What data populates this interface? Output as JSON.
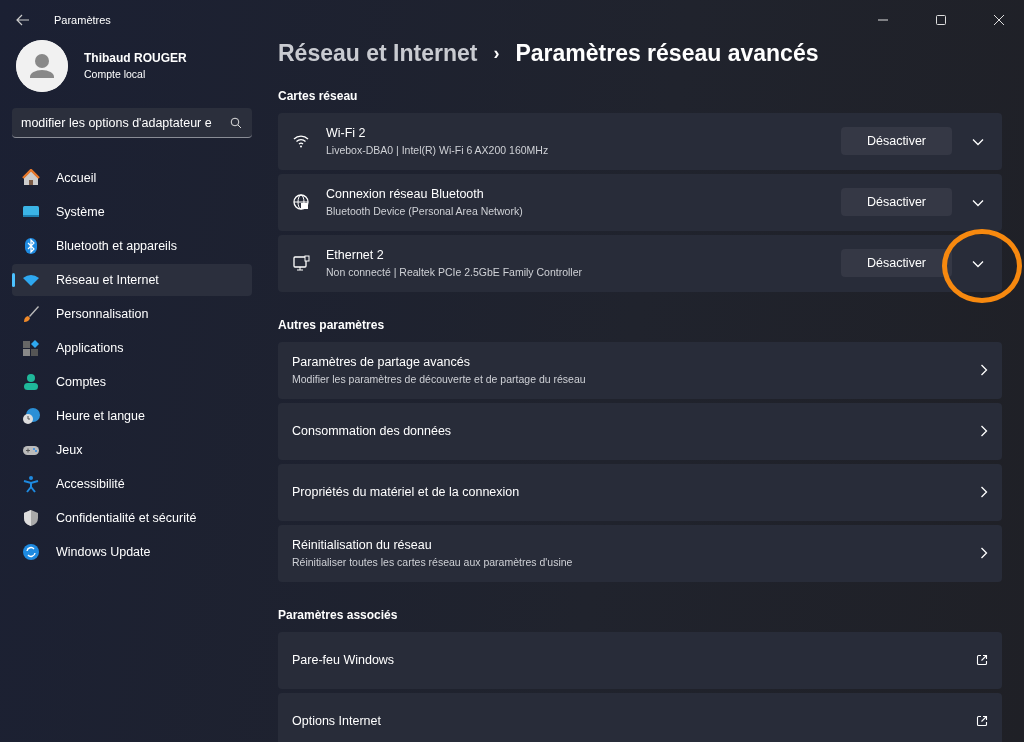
{
  "window": {
    "title": "Paramètres"
  },
  "user": {
    "name": "Thibaud ROUGER",
    "account": "Compte local"
  },
  "search": {
    "value": "modifier les options d'adaptateur e"
  },
  "sidebar": {
    "items": [
      {
        "label": "Accueil",
        "selected": false
      },
      {
        "label": "Système",
        "selected": false
      },
      {
        "label": "Bluetooth et appareils",
        "selected": false
      },
      {
        "label": "Réseau et Internet",
        "selected": true
      },
      {
        "label": "Personnalisation",
        "selected": false
      },
      {
        "label": "Applications",
        "selected": false
      },
      {
        "label": "Comptes",
        "selected": false
      },
      {
        "label": "Heure et langue",
        "selected": false
      },
      {
        "label": "Jeux",
        "selected": false
      },
      {
        "label": "Accessibilité",
        "selected": false
      },
      {
        "label": "Confidentialité et sécurité",
        "selected": false
      },
      {
        "label": "Windows Update",
        "selected": false
      }
    ]
  },
  "breadcrumb": {
    "parent": "Réseau et Internet",
    "separator": "›",
    "current": "Paramètres réseau avancés"
  },
  "sections": [
    {
      "title": "Cartes réseau",
      "kind": "adapters",
      "rows": [
        {
          "title": "Wi-Fi 2",
          "subtitle": "Livebox-DBA0 | Intel(R) Wi-Fi 6 AX200 160MHz",
          "button": "Désactiver",
          "highlighted": false
        },
        {
          "title": "Connexion réseau Bluetooth",
          "subtitle": "Bluetooth Device (Personal Area Network)",
          "button": "Désactiver",
          "highlighted": false
        },
        {
          "title": "Ethernet 2",
          "subtitle": "Non connecté | Realtek PCIe 2.5GbE Family Controller",
          "button": "Désactiver",
          "highlighted": true
        }
      ]
    },
    {
      "title": "Autres paramètres",
      "kind": "links",
      "rows": [
        {
          "title": "Paramètres de partage avancés",
          "subtitle": "Modifier les paramètres de découverte et de partage du réseau"
        },
        {
          "title": "Consommation des données"
        },
        {
          "title": "Propriétés du matériel et de la connexion"
        },
        {
          "title": "Réinitialisation du réseau",
          "subtitle": "Réinitialiser toutes les cartes réseau aux paramètres d'usine"
        }
      ]
    },
    {
      "title": "Paramètres associés",
      "kind": "external",
      "rows": [
        {
          "title": "Pare-feu Windows"
        },
        {
          "title": "Options Internet"
        }
      ]
    }
  ]
}
